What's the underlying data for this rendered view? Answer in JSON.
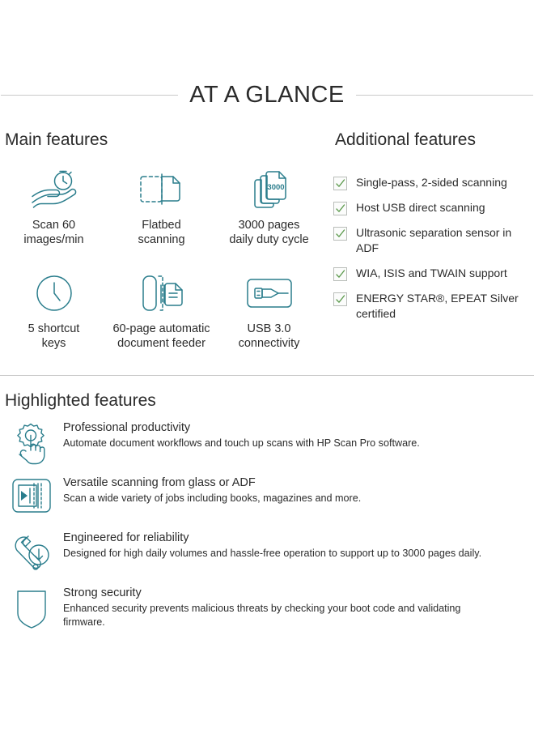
{
  "title": "AT A GLANCE",
  "sections": {
    "main_features_heading": "Main features",
    "additional_features_heading": "Additional features",
    "highlighted_features_heading": "Highlighted features"
  },
  "colors": {
    "icon_teal": "#2a7d8c",
    "icon_teal_light": "#49a3ae",
    "check_green": "#5c9a4d",
    "rule_gray": "#c9c9c9",
    "text": "#2b2b2b"
  },
  "main_features": [
    {
      "icon": "hand-stopwatch-icon",
      "label": "Scan 60\nimages/min"
    },
    {
      "icon": "flatbed-scan-icon",
      "label": "Flatbed\nscanning"
    },
    {
      "icon": "stacked-pages-3000-icon",
      "label": "3000 pages\ndaily duty cycle",
      "badge": "3000"
    },
    {
      "icon": "clock-icon",
      "label": "5 shortcut\nkeys"
    },
    {
      "icon": "document-feeder-icon",
      "label": "60-page automatic\ndocument feeder"
    },
    {
      "icon": "usb-connector-icon",
      "label": "USB 3.0\nconnectivity"
    }
  ],
  "additional_features": [
    {
      "icon": "checkbox-checked-icon",
      "text": "Single-pass, 2-sided scanning"
    },
    {
      "icon": "checkbox-checked-icon",
      "text": "Host USB direct scanning"
    },
    {
      "icon": "checkbox-checked-icon",
      "text": "Ultrasonic separation sensor in ADF"
    },
    {
      "icon": "checkbox-checked-icon",
      "text": "WIA, ISIS and TWAIN support"
    },
    {
      "icon": "checkbox-checked-icon",
      "text": "ENERGY STAR®, EPEAT Silver certified"
    }
  ],
  "highlighted_features": [
    {
      "icon": "gear-hand-icon",
      "title": "Professional productivity",
      "desc": "Automate document workflows and touch up scans with HP Scan Pro software."
    },
    {
      "icon": "scan-glass-adf-icon",
      "title": "Versatile scanning from glass or ADF",
      "desc": "Scan a wide variety of jobs including books, magazines and more."
    },
    {
      "icon": "wrench-download-icon",
      "title": "Engineered for reliability",
      "desc": "Designed for high daily volumes and hassle-free operation to support up to 3000 pages daily."
    },
    {
      "icon": "shield-icon",
      "title": "Strong security",
      "desc": "Enhanced security prevents malicious threats by checking your boot code and validating firmware."
    }
  ]
}
